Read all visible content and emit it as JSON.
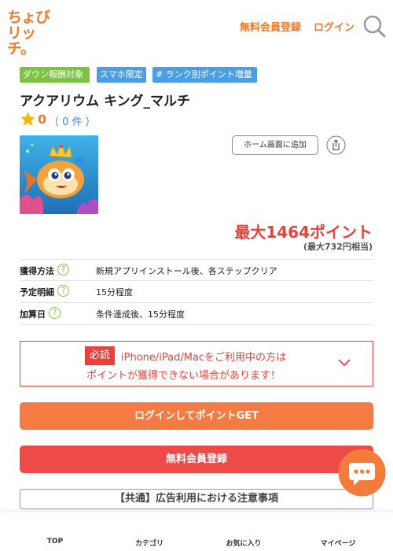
{
  "header": {
    "logo_line1": "ちょび",
    "logo_line2": "リッチ。",
    "signup_label": "無料会員登録",
    "login_label": "ログイン",
    "search_icon": "search-icon",
    "accent_color": "#f07a2c"
  },
  "tags": [
    {
      "label": "ダウン報酬対象",
      "color": "#7dc242"
    },
    {
      "label": "スマホ限定",
      "color": "#4a9ee8"
    },
    {
      "label": "# ランク別ポイント増量",
      "color": "#4a9ee8"
    }
  ],
  "app": {
    "title": "アクアリウム キング_マルチ",
    "rating_value": "0",
    "rating_count": "（ 0 件 ）",
    "home_button_label": "ホーム画面に追加",
    "share_icon": "share-icon"
  },
  "points": {
    "main": "最大1464ポイント",
    "sub": "(最大732円相当)"
  },
  "info_rows": [
    {
      "label": "獲得方法",
      "value": "新規アプリインストール後、各ステップクリア"
    },
    {
      "label": "予定明細",
      "value": "15分程度"
    },
    {
      "label": "加算日",
      "value": "条件達成後、15分程度"
    }
  ],
  "help_mark": "?",
  "warning": {
    "badge": "必読",
    "line1": "iPhone/iPad/Macをご利用中の方は",
    "line2": "ポイントが獲得できない場合があります！"
  },
  "buttons": {
    "login_points": "ログインしてポイントGET",
    "signup": "無料会員登録",
    "notice": "【共通】広告利用における注意事項"
  },
  "bottom_nav": [
    {
      "label": "TOP"
    },
    {
      "label": "カテゴリ"
    },
    {
      "label": "お気に入り"
    },
    {
      "label": "マイページ"
    }
  ]
}
